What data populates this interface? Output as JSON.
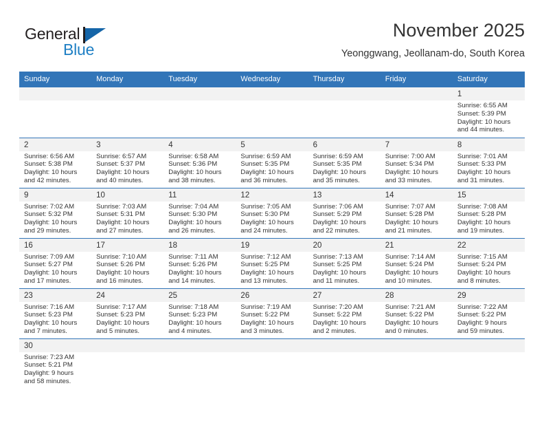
{
  "brand": {
    "name_part1": "General",
    "name_part2": "Blue",
    "triangle_color": "#1565a8",
    "blue_color": "#1e7fc4"
  },
  "header": {
    "title": "November 2025",
    "location": "Yeonggwang, Jeollanam-do, South Korea",
    "header_bg_color": "#3275b8",
    "daynum_bg_color": "#f2f2f2"
  },
  "weekdays": [
    "Sunday",
    "Monday",
    "Tuesday",
    "Wednesday",
    "Thursday",
    "Friday",
    "Saturday"
  ],
  "weeks": [
    [
      {
        "day": "",
        "blank": true
      },
      {
        "day": "",
        "blank": true
      },
      {
        "day": "",
        "blank": true
      },
      {
        "day": "",
        "blank": true
      },
      {
        "day": "",
        "blank": true
      },
      {
        "day": "",
        "blank": true
      },
      {
        "day": "1",
        "sunrise": "Sunrise: 6:55 AM",
        "sunset": "Sunset: 5:39 PM",
        "daylight1": "Daylight: 10 hours",
        "daylight2": "and 44 minutes."
      }
    ],
    [
      {
        "day": "2",
        "sunrise": "Sunrise: 6:56 AM",
        "sunset": "Sunset: 5:38 PM",
        "daylight1": "Daylight: 10 hours",
        "daylight2": "and 42 minutes."
      },
      {
        "day": "3",
        "sunrise": "Sunrise: 6:57 AM",
        "sunset": "Sunset: 5:37 PM",
        "daylight1": "Daylight: 10 hours",
        "daylight2": "and 40 minutes."
      },
      {
        "day": "4",
        "sunrise": "Sunrise: 6:58 AM",
        "sunset": "Sunset: 5:36 PM",
        "daylight1": "Daylight: 10 hours",
        "daylight2": "and 38 minutes."
      },
      {
        "day": "5",
        "sunrise": "Sunrise: 6:59 AM",
        "sunset": "Sunset: 5:35 PM",
        "daylight1": "Daylight: 10 hours",
        "daylight2": "and 36 minutes."
      },
      {
        "day": "6",
        "sunrise": "Sunrise: 6:59 AM",
        "sunset": "Sunset: 5:35 PM",
        "daylight1": "Daylight: 10 hours",
        "daylight2": "and 35 minutes."
      },
      {
        "day": "7",
        "sunrise": "Sunrise: 7:00 AM",
        "sunset": "Sunset: 5:34 PM",
        "daylight1": "Daylight: 10 hours",
        "daylight2": "and 33 minutes."
      },
      {
        "day": "8",
        "sunrise": "Sunrise: 7:01 AM",
        "sunset": "Sunset: 5:33 PM",
        "daylight1": "Daylight: 10 hours",
        "daylight2": "and 31 minutes."
      }
    ],
    [
      {
        "day": "9",
        "sunrise": "Sunrise: 7:02 AM",
        "sunset": "Sunset: 5:32 PM",
        "daylight1": "Daylight: 10 hours",
        "daylight2": "and 29 minutes."
      },
      {
        "day": "10",
        "sunrise": "Sunrise: 7:03 AM",
        "sunset": "Sunset: 5:31 PM",
        "daylight1": "Daylight: 10 hours",
        "daylight2": "and 27 minutes."
      },
      {
        "day": "11",
        "sunrise": "Sunrise: 7:04 AM",
        "sunset": "Sunset: 5:30 PM",
        "daylight1": "Daylight: 10 hours",
        "daylight2": "and 26 minutes."
      },
      {
        "day": "12",
        "sunrise": "Sunrise: 7:05 AM",
        "sunset": "Sunset: 5:30 PM",
        "daylight1": "Daylight: 10 hours",
        "daylight2": "and 24 minutes."
      },
      {
        "day": "13",
        "sunrise": "Sunrise: 7:06 AM",
        "sunset": "Sunset: 5:29 PM",
        "daylight1": "Daylight: 10 hours",
        "daylight2": "and 22 minutes."
      },
      {
        "day": "14",
        "sunrise": "Sunrise: 7:07 AM",
        "sunset": "Sunset: 5:28 PM",
        "daylight1": "Daylight: 10 hours",
        "daylight2": "and 21 minutes."
      },
      {
        "day": "15",
        "sunrise": "Sunrise: 7:08 AM",
        "sunset": "Sunset: 5:28 PM",
        "daylight1": "Daylight: 10 hours",
        "daylight2": "and 19 minutes."
      }
    ],
    [
      {
        "day": "16",
        "sunrise": "Sunrise: 7:09 AM",
        "sunset": "Sunset: 5:27 PM",
        "daylight1": "Daylight: 10 hours",
        "daylight2": "and 17 minutes."
      },
      {
        "day": "17",
        "sunrise": "Sunrise: 7:10 AM",
        "sunset": "Sunset: 5:26 PM",
        "daylight1": "Daylight: 10 hours",
        "daylight2": "and 16 minutes."
      },
      {
        "day": "18",
        "sunrise": "Sunrise: 7:11 AM",
        "sunset": "Sunset: 5:26 PM",
        "daylight1": "Daylight: 10 hours",
        "daylight2": "and 14 minutes."
      },
      {
        "day": "19",
        "sunrise": "Sunrise: 7:12 AM",
        "sunset": "Sunset: 5:25 PM",
        "daylight1": "Daylight: 10 hours",
        "daylight2": "and 13 minutes."
      },
      {
        "day": "20",
        "sunrise": "Sunrise: 7:13 AM",
        "sunset": "Sunset: 5:25 PM",
        "daylight1": "Daylight: 10 hours",
        "daylight2": "and 11 minutes."
      },
      {
        "day": "21",
        "sunrise": "Sunrise: 7:14 AM",
        "sunset": "Sunset: 5:24 PM",
        "daylight1": "Daylight: 10 hours",
        "daylight2": "and 10 minutes."
      },
      {
        "day": "22",
        "sunrise": "Sunrise: 7:15 AM",
        "sunset": "Sunset: 5:24 PM",
        "daylight1": "Daylight: 10 hours",
        "daylight2": "and 8 minutes."
      }
    ],
    [
      {
        "day": "23",
        "sunrise": "Sunrise: 7:16 AM",
        "sunset": "Sunset: 5:23 PM",
        "daylight1": "Daylight: 10 hours",
        "daylight2": "and 7 minutes."
      },
      {
        "day": "24",
        "sunrise": "Sunrise: 7:17 AM",
        "sunset": "Sunset: 5:23 PM",
        "daylight1": "Daylight: 10 hours",
        "daylight2": "and 5 minutes."
      },
      {
        "day": "25",
        "sunrise": "Sunrise: 7:18 AM",
        "sunset": "Sunset: 5:23 PM",
        "daylight1": "Daylight: 10 hours",
        "daylight2": "and 4 minutes."
      },
      {
        "day": "26",
        "sunrise": "Sunrise: 7:19 AM",
        "sunset": "Sunset: 5:22 PM",
        "daylight1": "Daylight: 10 hours",
        "daylight2": "and 3 minutes."
      },
      {
        "day": "27",
        "sunrise": "Sunrise: 7:20 AM",
        "sunset": "Sunset: 5:22 PM",
        "daylight1": "Daylight: 10 hours",
        "daylight2": "and 2 minutes."
      },
      {
        "day": "28",
        "sunrise": "Sunrise: 7:21 AM",
        "sunset": "Sunset: 5:22 PM",
        "daylight1": "Daylight: 10 hours",
        "daylight2": "and 0 minutes."
      },
      {
        "day": "29",
        "sunrise": "Sunrise: 7:22 AM",
        "sunset": "Sunset: 5:22 PM",
        "daylight1": "Daylight: 9 hours",
        "daylight2": "and 59 minutes."
      }
    ],
    [
      {
        "day": "30",
        "sunrise": "Sunrise: 7:23 AM",
        "sunset": "Sunset: 5:21 PM",
        "daylight1": "Daylight: 9 hours",
        "daylight2": "and 58 minutes."
      },
      {
        "day": "",
        "blank": true
      },
      {
        "day": "",
        "blank": true
      },
      {
        "day": "",
        "blank": true
      },
      {
        "day": "",
        "blank": true
      },
      {
        "day": "",
        "blank": true
      },
      {
        "day": "",
        "blank": true
      }
    ]
  ]
}
